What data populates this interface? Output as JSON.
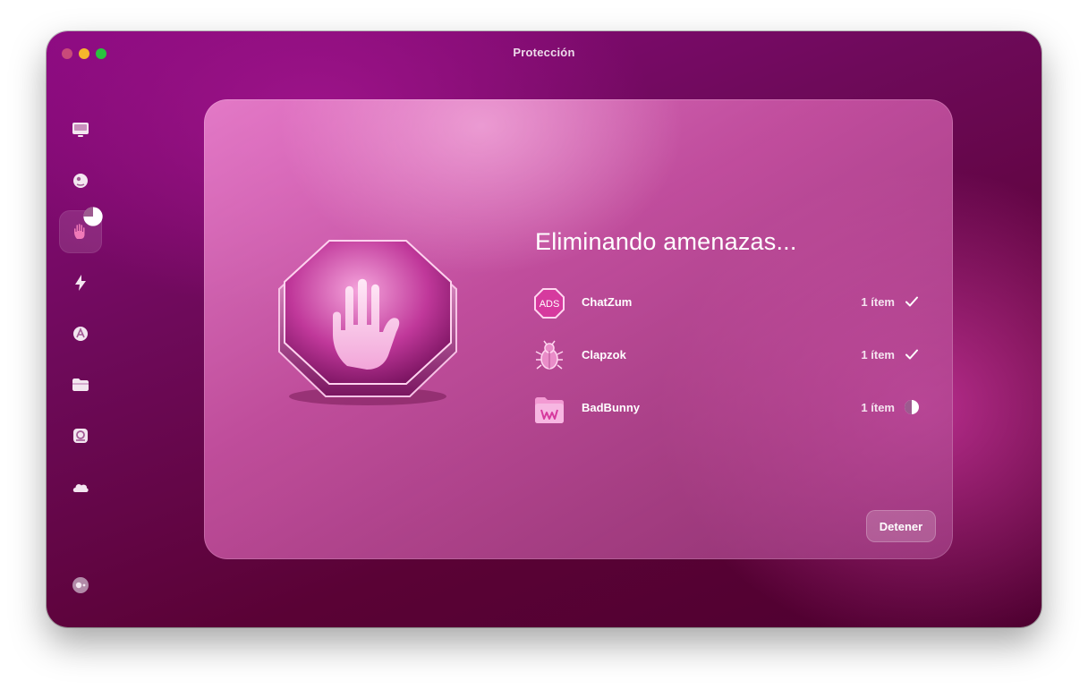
{
  "window": {
    "title": "Protección"
  },
  "sidebar": {
    "items": [
      {
        "icon": "monitor-icon",
        "active": false
      },
      {
        "icon": "bubble-icon",
        "active": false
      },
      {
        "icon": "hand-icon",
        "active": true,
        "progress_icon": "pie-progress-icon"
      },
      {
        "icon": "lightning-icon",
        "active": false
      },
      {
        "icon": "apps-icon",
        "active": false
      },
      {
        "icon": "folder-icon",
        "active": false
      },
      {
        "icon": "magnifier-icon",
        "active": false
      },
      {
        "icon": "cloud-icon",
        "active": false
      }
    ],
    "bottom_icon": "assistant-icon"
  },
  "main": {
    "heading": "Eliminando amenazas...",
    "threats": [
      {
        "name": "ChatZum",
        "count": "1 ítem",
        "icon": "ads-icon",
        "status": "done"
      },
      {
        "name": "Clapzok",
        "count": "1 ítem",
        "icon": "bug-icon",
        "status": "done"
      },
      {
        "name": "BadBunny",
        "count": "1 ítem",
        "icon": "folder-w-icon",
        "status": "in-progress"
      }
    ],
    "stop_label": "Detener"
  },
  "colors": {
    "accent": "#c03a9a",
    "traffic_close": "#c84a7a",
    "traffic_min": "#f6b62c",
    "traffic_max": "#29c23f"
  }
}
